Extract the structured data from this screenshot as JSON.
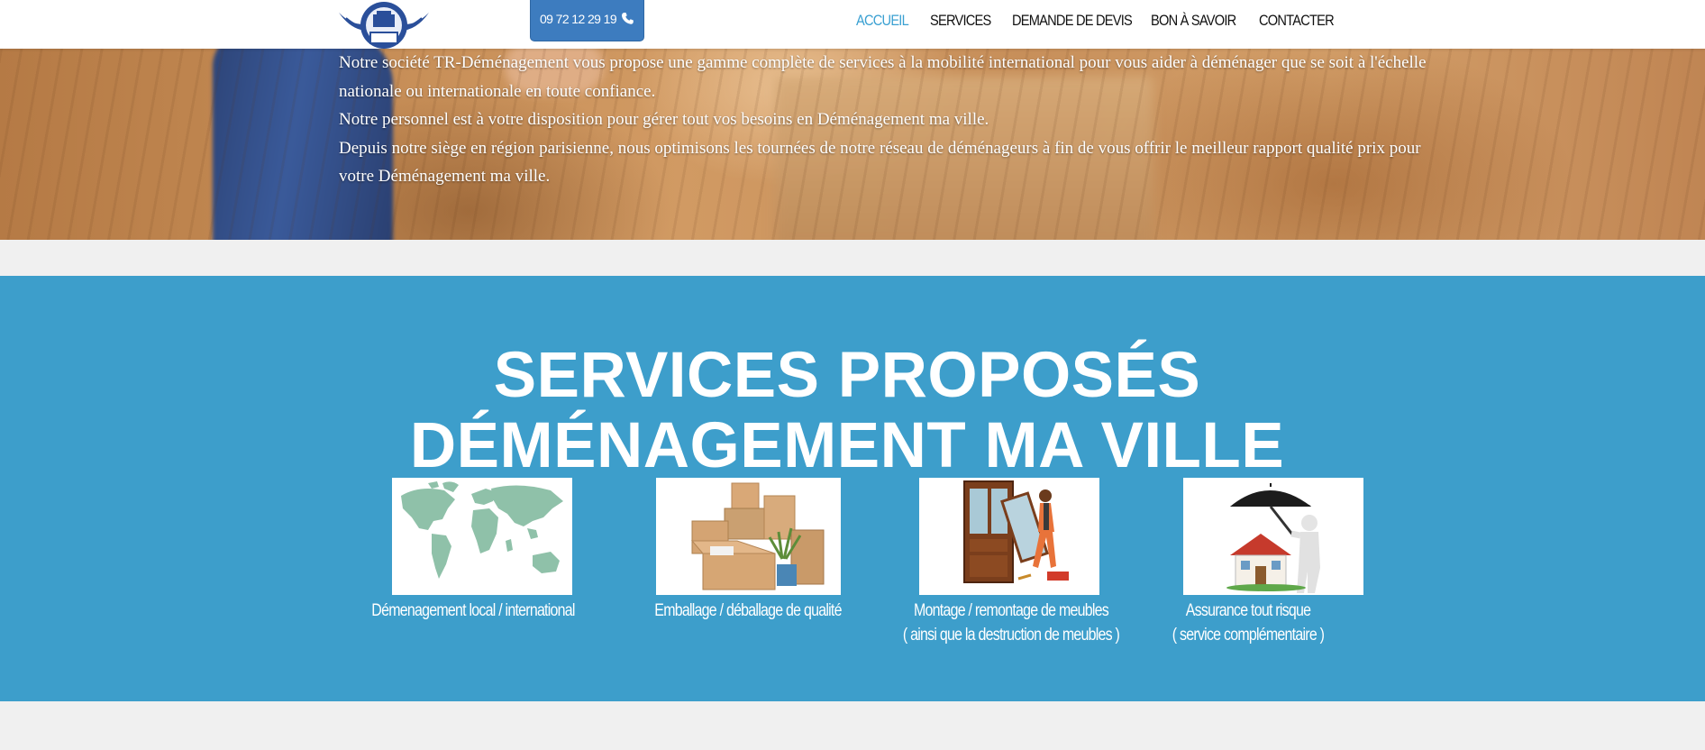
{
  "header": {
    "phone_label": "09 72 12 29 19",
    "nav": [
      {
        "label": "ACCUEIL",
        "active": true
      },
      {
        "label": "SERVICES",
        "active": false
      },
      {
        "label": "DEMANDE DE DEVIS",
        "active": false
      },
      {
        "label": "BON À SAVOIR",
        "active": false
      },
      {
        "label": "CONTACTER",
        "active": false
      }
    ]
  },
  "hero": {
    "paragraphs": [
      "Notre société TR-Déménagement vous propose une gamme complète de services à la mobilité international pour vous aider à déménager que se soit à l'échelle nationale ou internationale en toute confiance.",
      "Notre personnel est à votre disposition pour gérer tout vos besoins en Déménagement ma ville.",
      "Depuis notre siège en région parisienne, nous optimisons les tournées de notre réseau de déménageurs à fin de vous offrir le meilleur rapport qualité prix pour votre Déménagement ma ville."
    ]
  },
  "services": {
    "title_line1": "SERVICES PROPOSÉS",
    "title_line2": "DÉMÉNAGEMENT MA VILLE",
    "cards": [
      {
        "image": "world-map-icon",
        "line1": "Démenagement local / international",
        "line2": ""
      },
      {
        "image": "cardboard-boxes-icon",
        "line1": "Emballage / déballage de qualité",
        "line2": ""
      },
      {
        "image": "furniture-assembly-icon",
        "line1": "Montage / remontage de meubles",
        "line2": "( ainsi que la destruction de meubles )"
      },
      {
        "image": "house-umbrella-insurance-icon",
        "line1": "Assurance tout risque",
        "line2": "( service complémentaire )"
      }
    ]
  },
  "colors": {
    "accent_blue": "#3d9ecb",
    "nav_active": "#3aa0d2",
    "phone_button": "#3d7cbf",
    "page_background": "#f0f0f0"
  }
}
